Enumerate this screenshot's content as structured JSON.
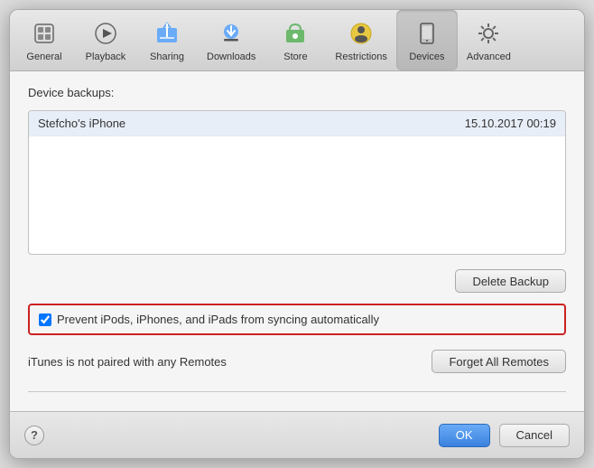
{
  "toolbar": {
    "items": [
      {
        "id": "general",
        "label": "General",
        "active": false
      },
      {
        "id": "playback",
        "label": "Playback",
        "active": false
      },
      {
        "id": "sharing",
        "label": "Sharing",
        "active": false
      },
      {
        "id": "downloads",
        "label": "Downloads",
        "active": false
      },
      {
        "id": "store",
        "label": "Store",
        "active": false
      },
      {
        "id": "restrictions",
        "label": "Restrictions",
        "active": false
      },
      {
        "id": "devices",
        "label": "Devices",
        "active": true
      },
      {
        "id": "advanced",
        "label": "Advanced",
        "active": false
      }
    ]
  },
  "content": {
    "device_backups_label": "Device backups:",
    "backup_device": "Stefcho's iPhone",
    "backup_date": "15.10.2017 00:19",
    "delete_backup_btn": "Delete Backup",
    "prevent_syncing_label": "Prevent iPods, iPhones, and iPads from syncing automatically",
    "prevent_syncing_checked": true,
    "remotes_text": "iTunes is not paired with any Remotes",
    "forget_remotes_btn": "Forget All Remotes"
  },
  "bottom": {
    "help_label": "?",
    "ok_label": "OK",
    "cancel_label": "Cancel"
  }
}
